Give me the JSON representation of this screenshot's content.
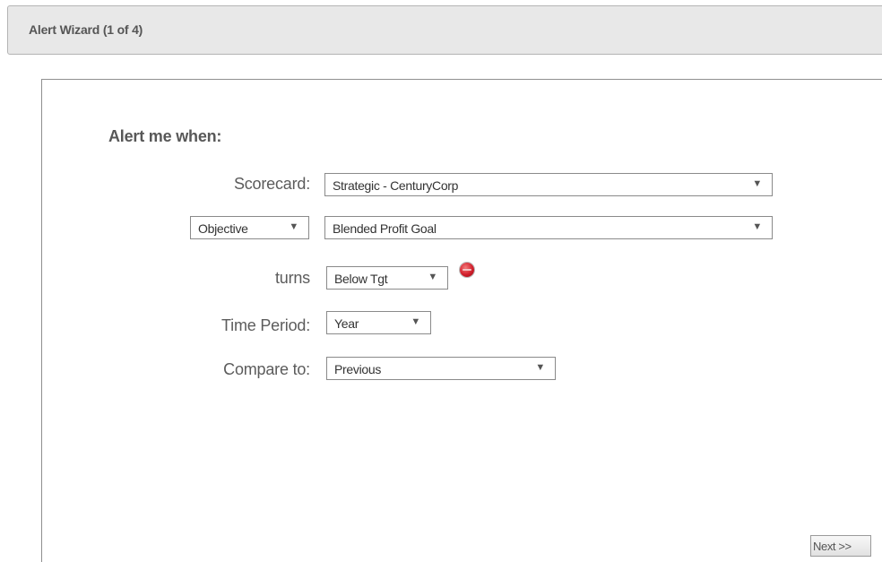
{
  "window": {
    "title": "Alert Wizard (1 of 4)"
  },
  "form": {
    "heading": "Alert me when:",
    "scorecard": {
      "label": "Scorecard:",
      "value": "Strategic - CenturyCorp"
    },
    "type": {
      "value": "Objective"
    },
    "item": {
      "value": "Blended Profit Goal"
    },
    "turns": {
      "label": "turns",
      "value": "Below Tgt",
      "status_color": "#d21f2c",
      "status_icon": "red-status-indicator-icon"
    },
    "time_period": {
      "label": "Time Period:",
      "value": "Year"
    },
    "compare_to": {
      "label": "Compare to:",
      "value": "Previous"
    }
  },
  "actions": {
    "next_label": "Next >>"
  },
  "icons": {
    "dropdown_arrow": "▼"
  }
}
